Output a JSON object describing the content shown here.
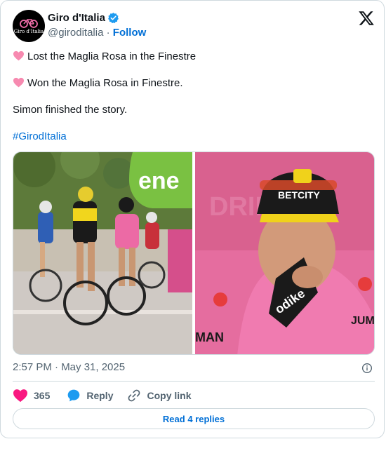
{
  "author": {
    "name": "Giro d'Italia",
    "handle": "@giroditalia",
    "separator": "·",
    "follow_label": "Follow",
    "avatar_logo_text": "Giro d'Italia"
  },
  "post": {
    "line1": "Lost the Maglia Rosa in the Finestre",
    "line2": "Won the Maglia Rosa in Finestre.",
    "line3": "Simon finished the story.",
    "hashtag": "#GirodItalia",
    "line_icon": "pink-heart-icon"
  },
  "media": {
    "photo1_sign_text": "ene",
    "photo2_cap_text": "BETCITY",
    "photo2_jersey_text": "odike"
  },
  "meta": {
    "timestamp": "2:57 PM · May 31, 2025"
  },
  "actions": {
    "like_count": "365",
    "reply_label": "Reply",
    "copy_link_label": "Copy link",
    "read_replies_label": "Read 4 replies"
  },
  "colors": {
    "link": "#006fd6",
    "like": "#f91880",
    "reply": "#1d9bf0",
    "verified": "#1d9bf0",
    "maglia_rosa": "#f06ea9"
  }
}
